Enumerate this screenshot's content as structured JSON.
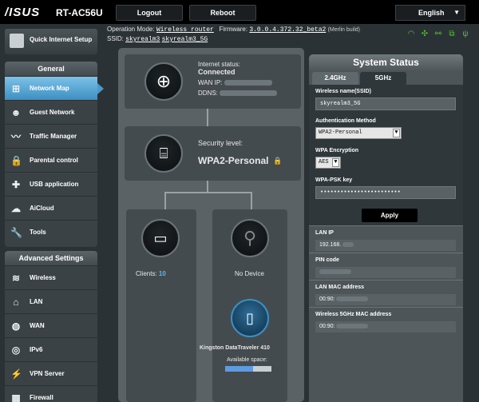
{
  "header": {
    "logo": "/ISUS",
    "model": "RT-AC56U",
    "logout_label": "Logout",
    "reboot_label": "Reboot",
    "language": "English"
  },
  "info": {
    "op_mode_label": "Operation Mode:",
    "op_mode_value": "Wireless router",
    "firmware_label": "Firmware:",
    "firmware_value": "3.0.0.4.372.32_beta2",
    "firmware_note": "(Merlin build)",
    "ssid_label": "SSID:",
    "ssid_24": "skyrealm3",
    "ssid_5": "skyrealm3_5G"
  },
  "sidebar": {
    "quick_setup": "Quick Internet Setup",
    "general_title": "General",
    "general_items": [
      {
        "label": "Network Map",
        "icon": "network-map-icon"
      },
      {
        "label": "Guest Network",
        "icon": "guest-network-icon"
      },
      {
        "label": "Traffic Manager",
        "icon": "traffic-manager-icon"
      },
      {
        "label": "Parental control",
        "icon": "parental-control-icon"
      },
      {
        "label": "USB application",
        "icon": "usb-application-icon"
      },
      {
        "label": "AiCloud",
        "icon": "aicloud-icon"
      },
      {
        "label": "Tools",
        "icon": "tools-icon"
      }
    ],
    "advanced_title": "Advanced Settings",
    "advanced_items": [
      {
        "label": "Wireless",
        "icon": "wireless-icon"
      },
      {
        "label": "LAN",
        "icon": "lan-icon"
      },
      {
        "label": "WAN",
        "icon": "wan-icon"
      },
      {
        "label": "IPv6",
        "icon": "ipv6-icon"
      },
      {
        "label": "VPN Server",
        "icon": "vpn-server-icon"
      },
      {
        "label": "Firewall",
        "icon": "firewall-icon"
      }
    ]
  },
  "map": {
    "internet_status_label": "Internet status:",
    "internet_status_value": "Connected",
    "wan_ip_label": "WAN IP:",
    "ddns_label": "DDNS:",
    "security_label": "Security level:",
    "security_value": "WPA2-Personal",
    "clients_label": "Clients:",
    "clients_count": "10",
    "no_device": "No Device",
    "usb_device": "Kingston DataTraveler 410",
    "available_space": "Available space:",
    "space_used_fraction": 0.6
  },
  "status_panel": {
    "title": "System Status",
    "tab_24": "2.4GHz",
    "tab_5": "5GHz",
    "ssid_label": "Wireless name(SSID)",
    "ssid_value": "skyrealm3_5G",
    "auth_label": "Authentication Method",
    "auth_value": "WPA2-Personal",
    "enc_label": "WPA Encryption",
    "enc_value": "AES",
    "psk_label": "WPA-PSK key",
    "psk_value": "••••••••••••••••••••••••",
    "apply_label": "Apply",
    "lan_ip_label": "LAN IP",
    "lan_ip_value": "192.168.",
    "pin_label": "PIN code",
    "lan_mac_label": "LAN MAC address",
    "lan_mac_value": "00:90:",
    "wl5_mac_label": "Wireless 5GHz MAC address",
    "wl5_mac_value": "00:90:"
  },
  "colors": {
    "accent": "#3d8fc2",
    "status_icon": "#55c22f",
    "space_bar": "#5d9be0"
  }
}
